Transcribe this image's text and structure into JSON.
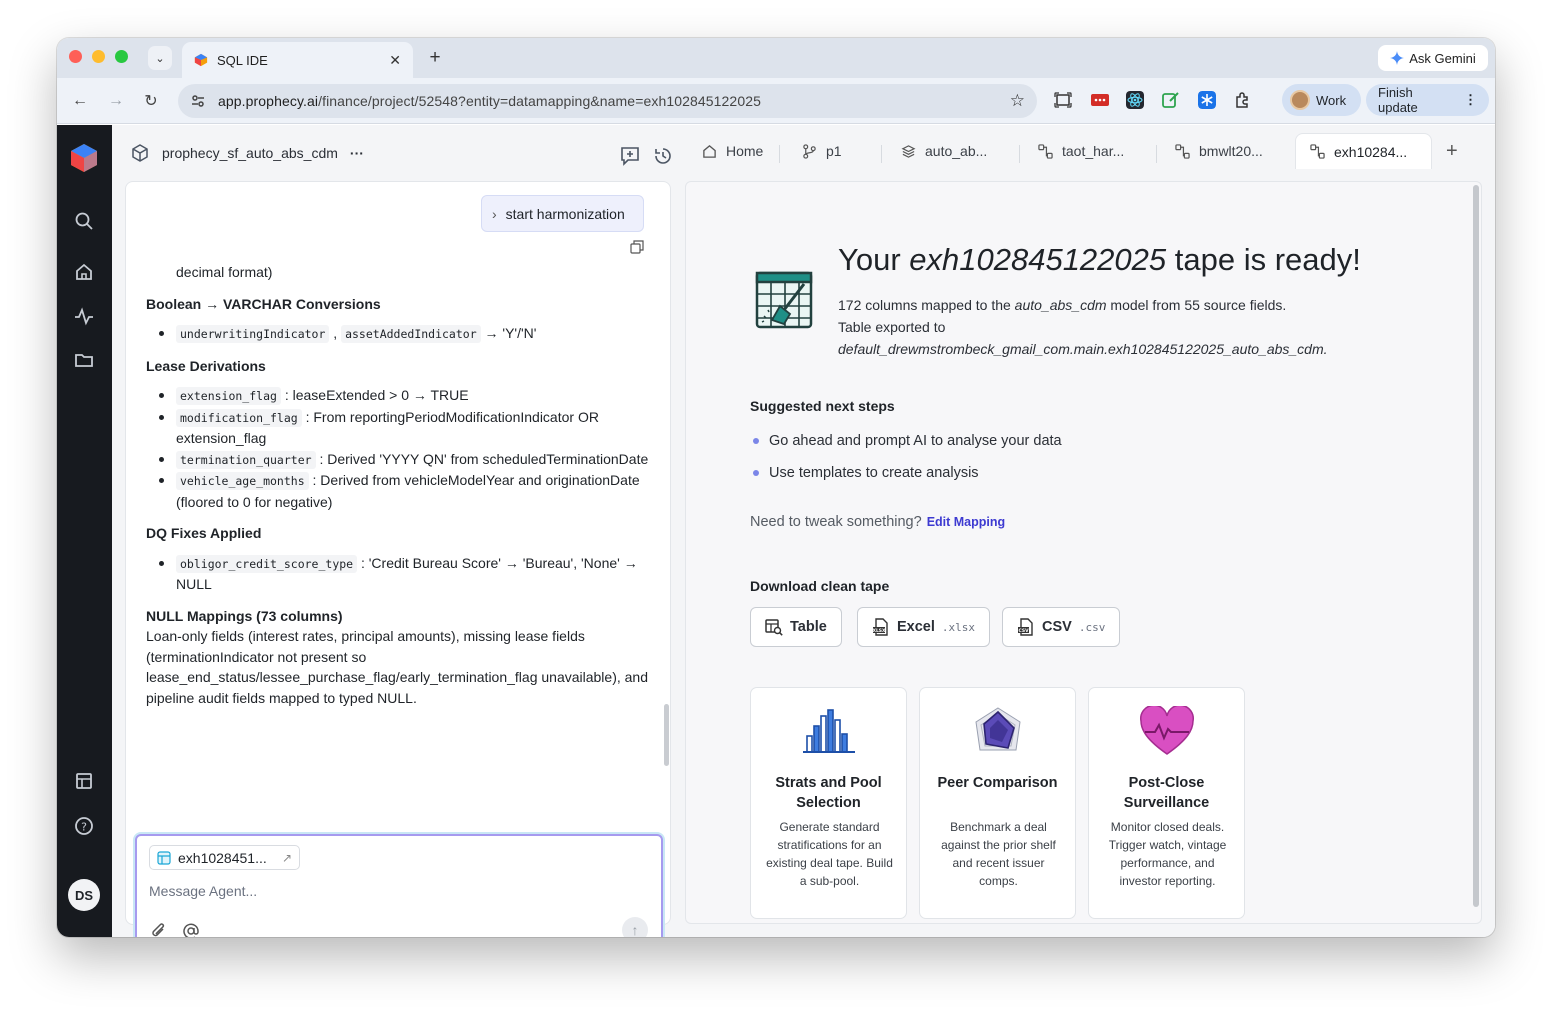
{
  "browser": {
    "tab_title": "SQL IDE",
    "url_host": "app.prophecy.ai",
    "url_path": "/finance/project/52548?entity=datamapping&name=exh102845122025",
    "ask_gemini": "Ask Gemini",
    "profile": "Work",
    "finish_update": "Finish update"
  },
  "rail": {
    "avatar": "DS"
  },
  "project": {
    "name": "prophecy_sf_auto_abs_cdm",
    "more": "···"
  },
  "tabs": [
    {
      "label": "Home"
    },
    {
      "label": "p1"
    },
    {
      "label": "auto_ab..."
    },
    {
      "label": "taot_har..."
    },
    {
      "label": "bmwlt20..."
    },
    {
      "label": "exh10284..."
    }
  ],
  "chat": {
    "start_harmonization": "start harmonization",
    "decimal_tail": "decimal format)",
    "h_bool": "Boolean → VARCHAR Conversions",
    "bool_code1": "underwritingIndicator",
    "bool_sep": ",",
    "bool_code2": "assetAddedIndicator",
    "bool_text": "→ 'Y'/'N'",
    "h_lease": "Lease Derivations",
    "lease": [
      {
        "code": "extension_flag",
        "text": ": leaseExtended > 0 → TRUE"
      },
      {
        "code": "modification_flag",
        "text": ": From reportingPeriodModificationIndicator OR extension_flag"
      },
      {
        "code": "termination_quarter",
        "text": ": Derived 'YYYY QN' from scheduledTerminationDate"
      },
      {
        "code": "vehicle_age_months",
        "text": ": Derived from vehicleModelYear and originationDate (floored to 0 for negative)"
      }
    ],
    "h_dq": "DQ Fixes Applied",
    "dq_code": "obligor_credit_score_type",
    "dq_text": ": 'Credit Bureau Score' → 'Bureau', 'None' → NULL",
    "h_null": "NULL Mappings (73 columns)",
    "null_text": "Loan-only fields (interest rates, principal amounts), missing lease fields (terminationIndicator not present so lease_end_status/lessee_purchase_flag/early_termination_flag unavailable), and pipeline audit fields mapped to typed NULL.",
    "chip_label": "exh1028451...",
    "placeholder": "Message Agent..."
  },
  "result": {
    "title_pre": "Your",
    "title_name": "exh102845122025",
    "title_post": "tape is ready!",
    "sub1_a": "172 columns mapped to the",
    "sub1_model": "auto_abs_cdm",
    "sub1_b": "model from 55 source fields.",
    "sub2": "Table exported to",
    "export_path": "default_drewmstrombeck_gmail_com.main.exh102845122025_auto_abs_cdm.",
    "next_steps_title": "Suggested next steps",
    "next_steps": [
      "Go ahead and prompt AI to analyse your data",
      "Use templates to create analysis"
    ],
    "tweak_text": "Need to tweak something?",
    "edit_mapping": "Edit Mapping",
    "download_title": "Download clean tape",
    "downloads": [
      {
        "label": "Table",
        "ext": ""
      },
      {
        "label": "Excel",
        "ext": ".xlsx"
      },
      {
        "label": "CSV",
        "ext": ".csv"
      }
    ],
    "cards": [
      {
        "title": "Strats and Pool Selection",
        "desc": "Generate standard stratifications for an existing deal tape. Build a sub-pool."
      },
      {
        "title": "Peer Comparison",
        "desc": "Benchmark a deal against the prior shelf and recent issuer comps."
      },
      {
        "title": "Post-Close Surveillance",
        "desc": "Monitor closed deals. Trigger watch, vintage performance, and investor reporting."
      }
    ]
  },
  "colors": {
    "accent": "#3d3ad1",
    "rail": "#171a1f",
    "input_border": "#a69aef"
  }
}
